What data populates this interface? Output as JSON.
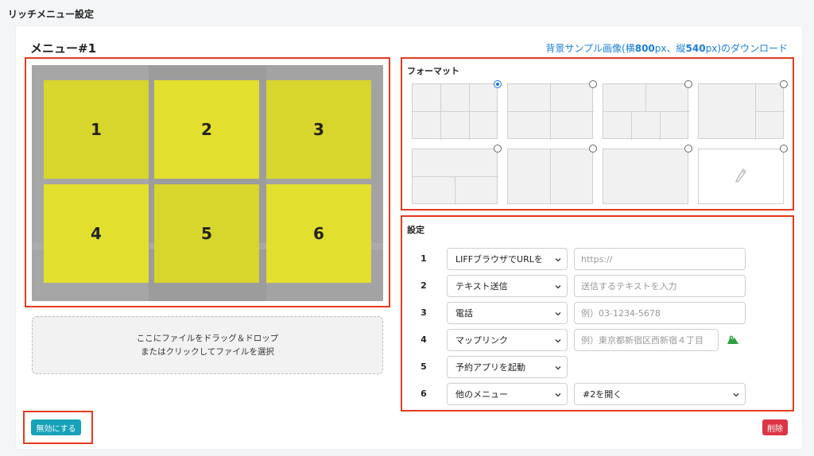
{
  "page": {
    "title": "リッチメニュー設定"
  },
  "menu": {
    "title": "メニュー#1",
    "download_prefix": "背景サンプル画像(横",
    "download_w": "800",
    "download_mid": "px、縦",
    "download_h": "540",
    "download_suffix": "px)のダウンロード"
  },
  "preview": {
    "cells": [
      "1",
      "2",
      "3",
      "4",
      "5",
      "6"
    ]
  },
  "dropzone": {
    "line1": "ここにファイルをドラッグ＆ドロップ",
    "line2": "またはクリックしてファイルを選択"
  },
  "format": {
    "title": "フォーマット",
    "selected_index": 0,
    "count": 8
  },
  "settings": {
    "title": "設定",
    "rows": [
      {
        "num": "1",
        "action": "LIFFブラウザでURLを",
        "placeholder": "https://"
      },
      {
        "num": "2",
        "action": "テキスト送信",
        "placeholder": "送信するテキストを入力"
      },
      {
        "num": "3",
        "action": "電話",
        "placeholder": "例）03-1234-5678"
      },
      {
        "num": "4",
        "action": "マップリンク",
        "placeholder": "例）東京都新宿区西新宿４丁目"
      },
      {
        "num": "5",
        "action": "予約アプリを起動"
      },
      {
        "num": "6",
        "action": "他のメニュー",
        "value": "#2を開く"
      }
    ]
  },
  "buttons": {
    "disable": "無効にする",
    "delete": "削除"
  },
  "colors": {
    "accent": "#e53a1e",
    "link": "#1a7fd6",
    "cell": "#e3df2e",
    "disable": "#17a2b8",
    "delete": "#dc3545"
  }
}
